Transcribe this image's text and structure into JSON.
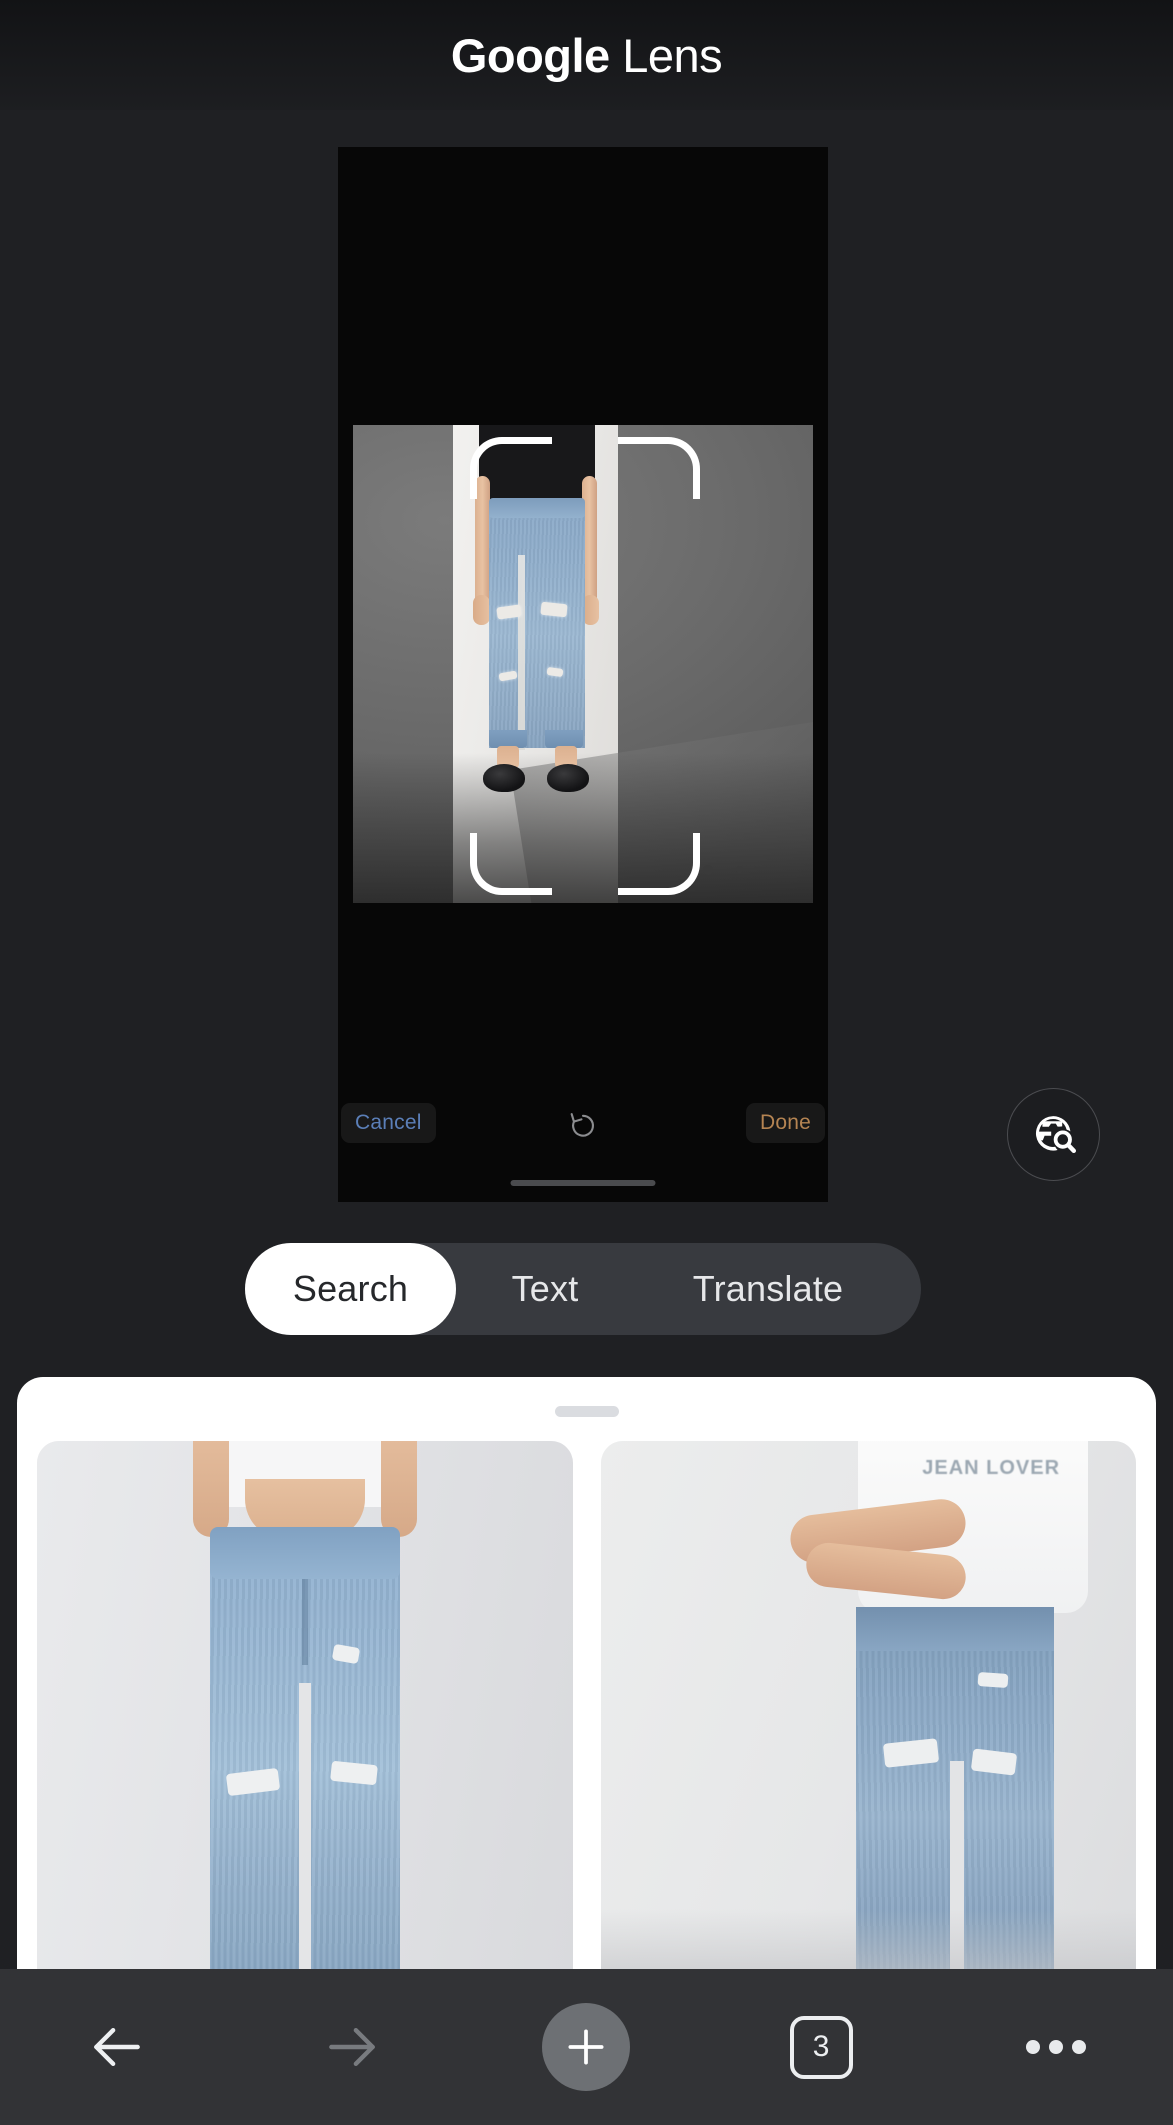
{
  "header": {
    "brand_bold": "Google",
    "brand_light": "Lens"
  },
  "viewer": {
    "edit_bar": {
      "cancel_label": "Cancel",
      "done_label": "Done",
      "rotate_icon": "rotate-counter-clockwise-icon",
      "cancel_color": "#5b7fb8",
      "done_color": "#b58452"
    },
    "crop_frame": {
      "icon": "crop-brackets",
      "subject": "light-wash distressed mom jeans on person wearing black tee and black slippers"
    },
    "home_indicator": "home-bar"
  },
  "lens_button": {
    "icon": "lens-search-globe-icon",
    "label": ""
  },
  "tabs": [
    {
      "id": "search",
      "label": "Search",
      "active": true
    },
    {
      "id": "text",
      "label": "Text",
      "active": false
    },
    {
      "id": "translate",
      "label": "Translate",
      "active": false
    }
  ],
  "results_sheet": {
    "handle": "drag-handle",
    "cards": [
      {
        "id": "result-1",
        "alt": "light blue high-waist distressed mom jeans front view",
        "tee_text": ""
      },
      {
        "id": "result-2",
        "alt": "person in white graphic tee and blue distressed jeans",
        "tee_text": "JEAN LOVER"
      }
    ]
  },
  "toolbar": {
    "back_icon": "arrow-left-icon",
    "forward_icon": "arrow-right-icon",
    "new_tab_icon": "plus-icon",
    "tab_count": "3",
    "more_icon": "three-dots-icon"
  },
  "colors": {
    "app_background": "#1f2023",
    "viewer_background": "#070707",
    "tab_track": "#383a3f",
    "tab_active": "#ffffff",
    "toolbar": "#323336",
    "sheet": "#ffffff"
  }
}
